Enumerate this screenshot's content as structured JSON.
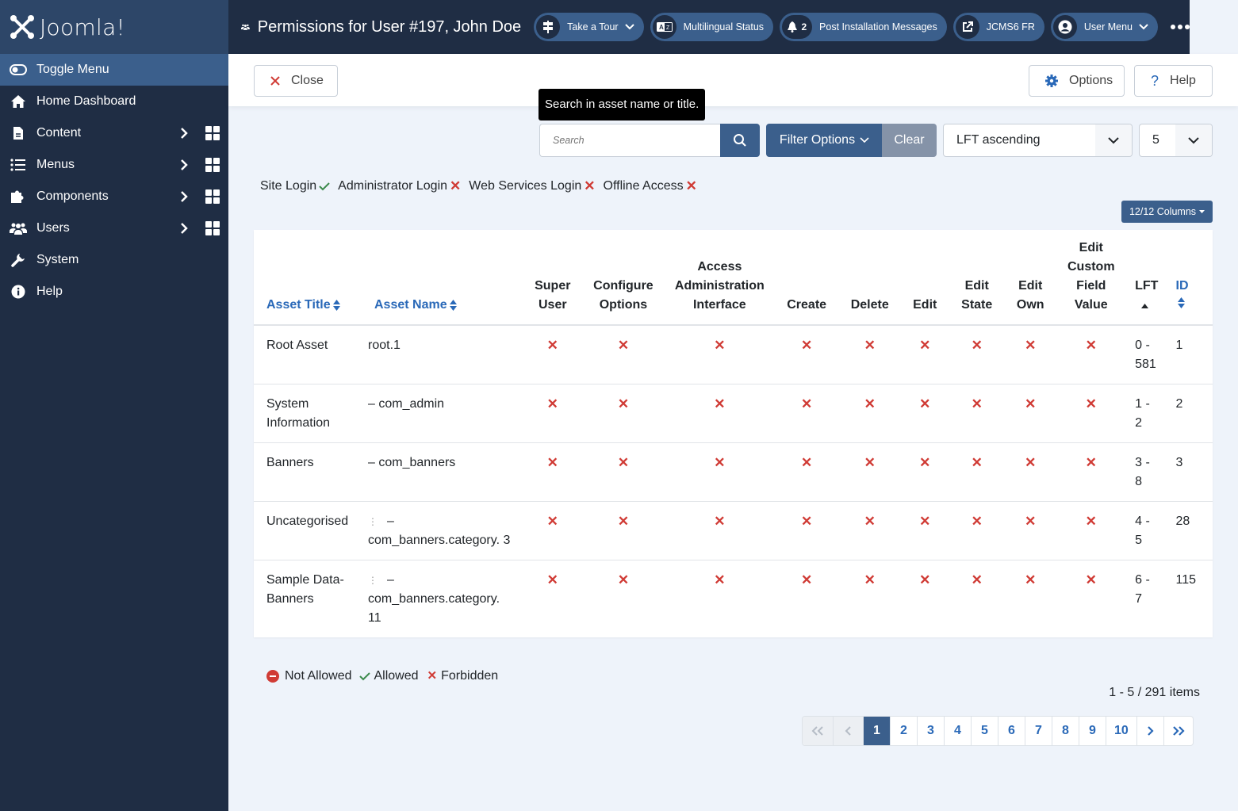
{
  "app": {
    "logo_text": "Joomla!"
  },
  "sidebar": {
    "toggle_label": "Toggle Menu",
    "items": [
      {
        "label": "Home Dashboard",
        "icon": "home-icon",
        "submenu": false
      },
      {
        "label": "Content",
        "icon": "file-icon",
        "submenu": true
      },
      {
        "label": "Menus",
        "icon": "list-icon",
        "submenu": true
      },
      {
        "label": "Components",
        "icon": "puzzle-icon",
        "submenu": true
      },
      {
        "label": "Users",
        "icon": "users-icon",
        "submenu": true
      },
      {
        "label": "System",
        "icon": "wrench-icon",
        "submenu": false
      },
      {
        "label": "Help",
        "icon": "info-icon",
        "submenu": false
      }
    ]
  },
  "header": {
    "title": "Permissions for User #197, John Doe",
    "take_tour": "Take a Tour",
    "multilingual": "Multilingual Status",
    "post_install_count": "2",
    "post_install": "Post Installation Messages",
    "site_link": "JCMS6 FR",
    "user_menu": "User Menu"
  },
  "toolbar": {
    "close": "Close",
    "options": "Options",
    "help": "Help"
  },
  "search": {
    "tooltip": "Search in asset name or title.",
    "placeholder": "Search",
    "filter_options": "Filter Options",
    "clear": "Clear",
    "ordering": "LFT ascending",
    "limit": "5"
  },
  "logins": [
    {
      "label": "Site Login",
      "status": "allowed"
    },
    {
      "label": "Administrator Login",
      "status": "forbidden"
    },
    {
      "label": "Web Services Login",
      "status": "forbidden"
    },
    {
      "label": "Offline Access",
      "status": "forbidden"
    }
  ],
  "columns_button": "12/12 Columns",
  "table": {
    "headers": {
      "asset_title": "Asset Title",
      "asset_name": "Asset Name",
      "super_user": [
        "Super",
        "User"
      ],
      "configure": [
        "Configure",
        "Options"
      ],
      "access_admin": [
        "Access",
        "Administration",
        "Interface"
      ],
      "create": "Create",
      "delete": "Delete",
      "edit": "Edit",
      "edit_state": [
        "Edit",
        "State"
      ],
      "edit_own": [
        "Edit",
        "Own"
      ],
      "edit_custom": [
        "Edit",
        "Custom",
        "Field",
        "Value"
      ],
      "lft": "LFT",
      "id": "ID"
    },
    "rows": [
      {
        "title": "Root Asset",
        "name": "root.1",
        "indent": false,
        "perms": [
          "forbidden",
          "forbidden",
          "forbidden",
          "forbidden",
          "forbidden",
          "forbidden",
          "forbidden",
          "forbidden",
          "forbidden"
        ],
        "lft": "0 -",
        "rgt": "581",
        "id": "1"
      },
      {
        "title": "System Information",
        "name": "– com_admin",
        "indent": false,
        "perms": [
          "forbidden",
          "forbidden",
          "forbidden",
          "forbidden",
          "forbidden",
          "forbidden",
          "forbidden",
          "forbidden",
          "forbidden"
        ],
        "lft": "1 -",
        "rgt": "2",
        "id": "2"
      },
      {
        "title": "Banners",
        "name": "– com_banners",
        "indent": false,
        "perms": [
          "forbidden",
          "forbidden",
          "forbidden",
          "forbidden",
          "forbidden",
          "forbidden",
          "forbidden",
          "forbidden",
          "forbidden"
        ],
        "lft": "3 -",
        "rgt": "8",
        "id": "3"
      },
      {
        "title": "Uncategorised",
        "name": "– com_banners.category. 3",
        "indent": true,
        "perms": [
          "forbidden",
          "forbidden",
          "forbidden",
          "forbidden",
          "forbidden",
          "forbidden",
          "forbidden",
          "forbidden",
          "forbidden"
        ],
        "lft": "4 -",
        "rgt": "5",
        "id": "28"
      },
      {
        "title": "Sample Data-Banners",
        "name": "– com_banners.category. 11",
        "indent": true,
        "perms": [
          "forbidden",
          "forbidden",
          "forbidden",
          "forbidden",
          "forbidden",
          "forbidden",
          "forbidden",
          "forbidden",
          "forbidden"
        ],
        "lft": "6 -",
        "rgt": "7",
        "id": "115"
      }
    ]
  },
  "legend": {
    "not_allowed": "Not Allowed",
    "allowed": "Allowed",
    "forbidden": "Forbidden"
  },
  "pagination": {
    "summary": "1 - 5 / 291 items",
    "pages": [
      "1",
      "2",
      "3",
      "4",
      "5",
      "6",
      "7",
      "8",
      "9",
      "10"
    ],
    "current": "1"
  },
  "colors": {
    "primary": "#3b5f8c",
    "dark": "#1f2d44",
    "forbidden": "#d03b35",
    "allowed": "#3c8a4c",
    "link": "#2a69b8"
  }
}
